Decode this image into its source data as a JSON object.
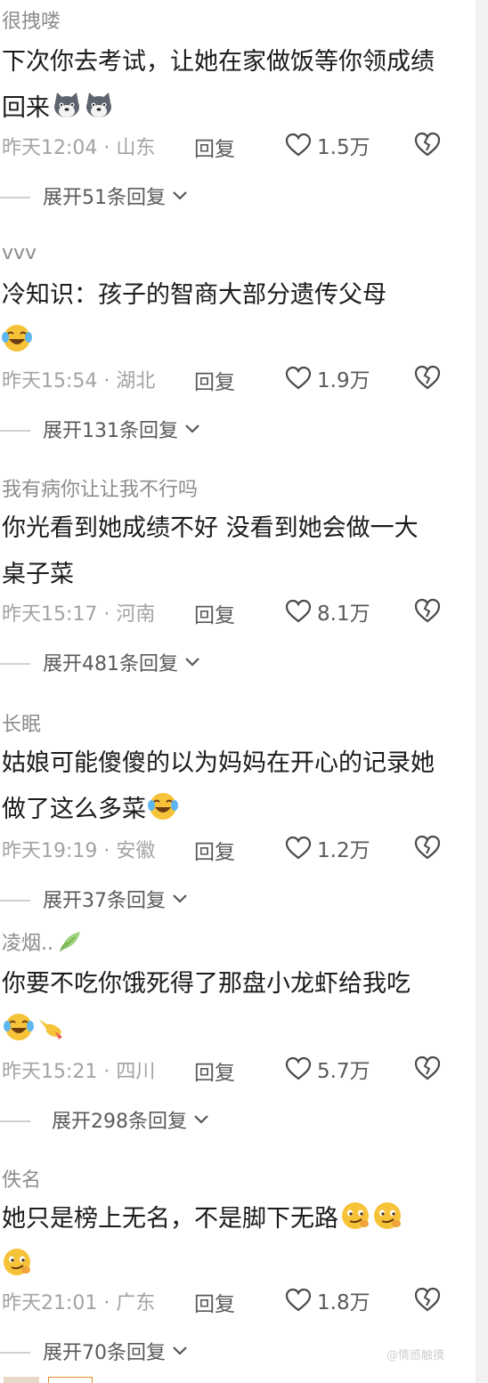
{
  "comments": [
    {
      "username": "很拽喽",
      "text": "下次你去考试，让她在家做饭等你领成绩回来",
      "emojis": [
        "husky-face-icon",
        "husky-face-icon"
      ],
      "time": "昨天12:04 · 山东",
      "reply": "回复",
      "likes": "1.5万",
      "expand": "展开51条回复"
    },
    {
      "username": "vvv",
      "text": "冷知识：孩子的智商大部分遗传父母",
      "emojis": [
        "laugh-cry-icon"
      ],
      "time": "昨天15:54 · 湖北",
      "reply": "回复",
      "likes": "1.9万",
      "expand": "展开131条回复"
    },
    {
      "username": "我有病你让让我不行吗",
      "text": "你光看到她成绩不好 没看到她会做一大桌子菜",
      "emojis": [],
      "time": "昨天15:17 · 河南",
      "reply": "回复",
      "likes": "8.1万",
      "expand": "展开481条回复"
    },
    {
      "username": "长眠",
      "text": "姑娘可能傻傻的以为妈妈在开心的记录她做了这么多菜",
      "emojis": [
        "laugh-cry-icon"
      ],
      "time": "昨天19:19 · 安徽",
      "reply": "回复",
      "likes": "1.2万",
      "expand": "展开37条回复"
    },
    {
      "username": "凌烟..",
      "username_emoji": "leaf-icon",
      "text": "你要不吃你饿死得了那盘小龙虾给我吃",
      "emojis": [
        "laugh-cry-icon",
        "pointing-hand-icon"
      ],
      "time": "昨天15:21 · 四川",
      "reply": "回复",
      "likes": "5.7万",
      "expand": "展开298条回复"
    },
    {
      "username": "佚名",
      "text": "她只是榜上无名，不是脚下无路",
      "emojis": [
        "smirk-face-icon",
        "smirk-face-icon",
        "smirk-face-icon"
      ],
      "time": "昨天21:01 · 广东",
      "reply": "回复",
      "likes": "1.8万",
      "expand": "展开70条回复"
    }
  ],
  "watermark": "@情感触摸",
  "colors": {
    "username": "#8c8c8c",
    "body": "#1b1b1b",
    "meta": "#a3a3a3",
    "action": "#5a5a5a",
    "divider": "#d0d0d0",
    "emoji_yellow": "#f6c338"
  }
}
